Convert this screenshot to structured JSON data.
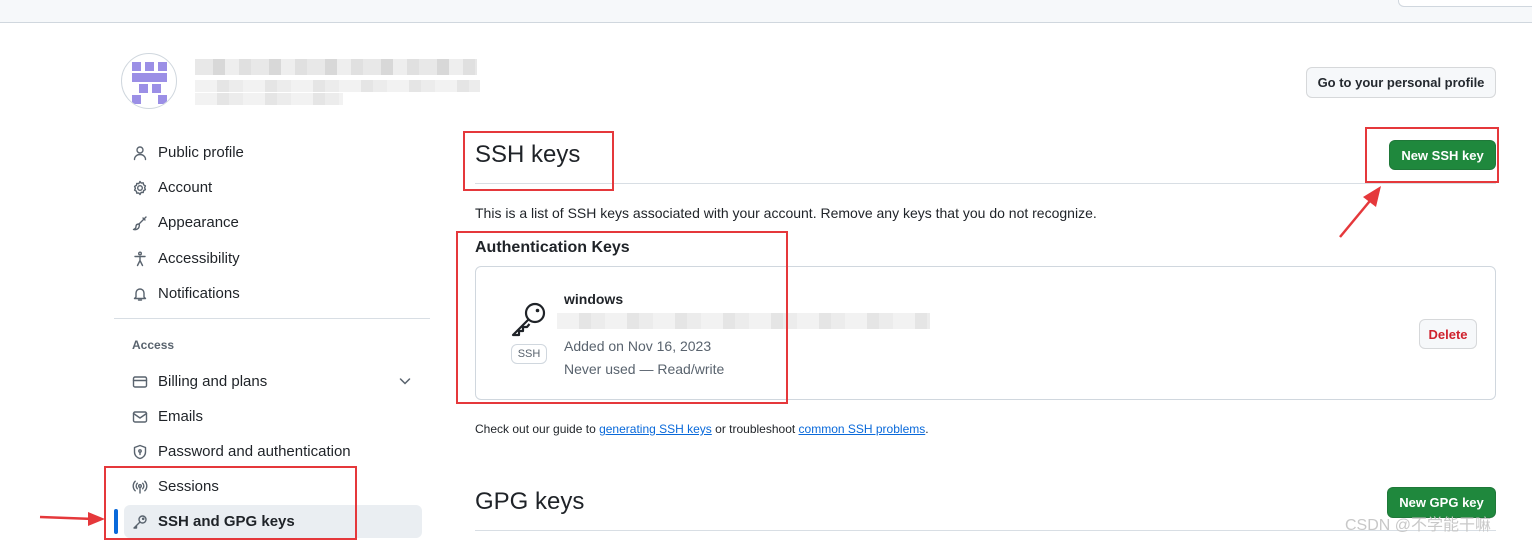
{
  "header": {
    "personal_profile_button": "Go to your personal profile"
  },
  "sidebar": {
    "items": [
      {
        "label": "Public profile",
        "icon": "person-icon"
      },
      {
        "label": "Account",
        "icon": "gear-icon"
      },
      {
        "label": "Appearance",
        "icon": "paintbrush-icon"
      },
      {
        "label": "Accessibility",
        "icon": "accessibility-icon"
      },
      {
        "label": "Notifications",
        "icon": "bell-icon"
      }
    ],
    "access_label": "Access",
    "access_items": [
      {
        "label": "Billing and plans",
        "icon": "credit-card-icon"
      },
      {
        "label": "Emails",
        "icon": "mail-icon"
      },
      {
        "label": "Password and authentication",
        "icon": "shield-lock-icon"
      },
      {
        "label": "Sessions",
        "icon": "broadcast-icon"
      },
      {
        "label": "SSH and GPG keys",
        "icon": "key-icon"
      }
    ],
    "active_item": "SSH and GPG keys"
  },
  "ssh": {
    "title": "SSH keys",
    "new_button": "New SSH key",
    "description": "This is a list of SSH keys associated with your account. Remove any keys that you do not recognize.",
    "auth_heading": "Authentication Keys",
    "key": {
      "name": "windows",
      "badge": "SSH",
      "added": "Added on Nov 16, 2023",
      "usage": "Never used — Read/write",
      "delete_button": "Delete"
    },
    "help": {
      "prefix": "Check out our guide to ",
      "link1": "generating SSH keys",
      "middle": " or troubleshoot ",
      "link2": "common SSH problems",
      "suffix": "."
    }
  },
  "gpg": {
    "title": "GPG keys",
    "new_button": "New GPG key"
  },
  "watermark": "CSDN @不学能干嘛",
  "colors": {
    "primary_button": "#1f883d",
    "danger_text": "#cf222e",
    "link": "#0969da",
    "active_indicator": "#0969da",
    "annotation": "#e5383b"
  }
}
